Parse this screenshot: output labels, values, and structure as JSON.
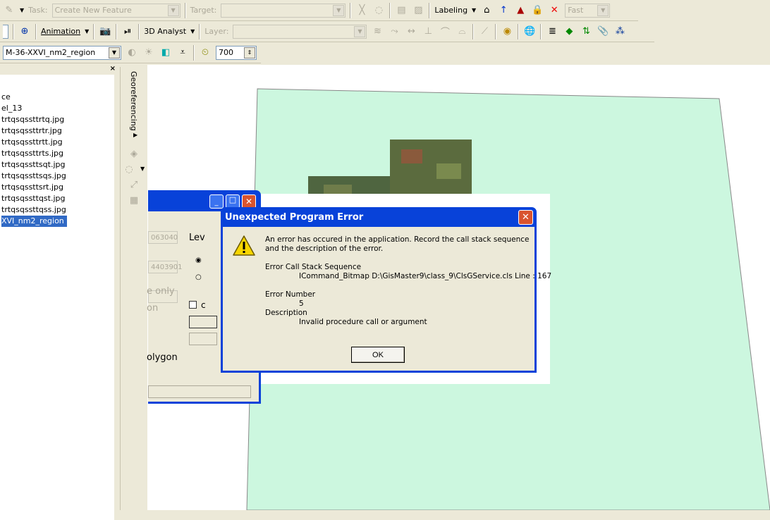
{
  "toolbar1": {
    "task_label": "Task:",
    "task_value": "Create New Feature",
    "target_label": "Target:",
    "target_value": "",
    "labeling": "Labeling",
    "fast_value": "Fast"
  },
  "toolbar2": {
    "animation": "Animation",
    "analyst": "3D Analyst",
    "layer_label": "Layer:",
    "layer_value": ""
  },
  "toolbar3": {
    "layer_value": "M-36-XXVI_nm2_region",
    "scale_value": "700"
  },
  "toc": {
    "items": [
      "ce",
      "el_13",
      "trtqsqssttrtq.jpg",
      "trtqsqssttrtr.jpg",
      "trtqsqssttrtt.jpg",
      "trtqsqssttrts.jpg",
      "trtqsqssttsqt.jpg",
      "trtqsqssttsqs.jpg",
      "trtqsqssttsrt.jpg",
      "trtqsqssttqst.jpg",
      "trtqsqssttqss.jpg"
    ],
    "selected": "XVI_nm2_region"
  },
  "georef": {
    "label": "Georeferencing"
  },
  "bg_window": {
    "field1": "063040",
    "field2": "4403901",
    "lev": "Lev",
    "only": "e only",
    "on": "on",
    "polygon": "olygon",
    "check": "c"
  },
  "error_dialog": {
    "title": "Unexpected Program Error",
    "message_line1": "An error has occured in the application.   Record the call stack sequence",
    "message_line2": "and the description of the error.",
    "stack_label": "Error Call Stack Sequence",
    "stack_value": "ICommand_Bitmap D:\\GisMaster9\\class_9\\ClsGService.cls Line : 167",
    "number_label": "Error Number",
    "number_value": "5",
    "desc_label": "Description",
    "desc_value": "Invalid procedure call or argument",
    "ok": "OK"
  },
  "colors": {
    "polygon_fill": "#ccf7df",
    "title_bar": "#0842d9",
    "selection": "#316ac5"
  }
}
